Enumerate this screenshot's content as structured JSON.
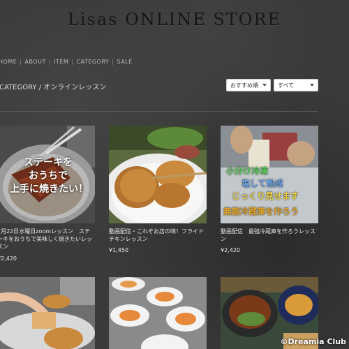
{
  "store": {
    "title": "Lisas ONLINE STORE"
  },
  "nav": [
    "HOME",
    "ABOUT",
    "ITEM",
    "CATEGORY",
    "SALE"
  ],
  "breadcrumb": "CATEGORY / オンラインレッスン",
  "filters": {
    "sort": "おすすめ順",
    "range": "すべて"
  },
  "products": [
    {
      "caption": "7月22日水曜日zoomレッスン　ステーキをおうちで美味しく焼きたいレッスン",
      "price": "¥2,420",
      "overlay": "ステーキを\nおうちで\n上手に焼きたい！"
    },
    {
      "caption": "動画配信・これぞお店の味！フライドチキンレッスン",
      "price": "¥1,450"
    },
    {
      "caption": "動画配信　最強冷蔵庫を作ろうレッスン",
      "price": "¥2,420",
      "overlay1": "小分け冷凍",
      "overlay2": "塩して熟成",
      "overlay3": "じっくり見せます",
      "overlay4": "無敵冷蔵庫を作ろう"
    }
  ],
  "watermark": "©Dreamia Club"
}
